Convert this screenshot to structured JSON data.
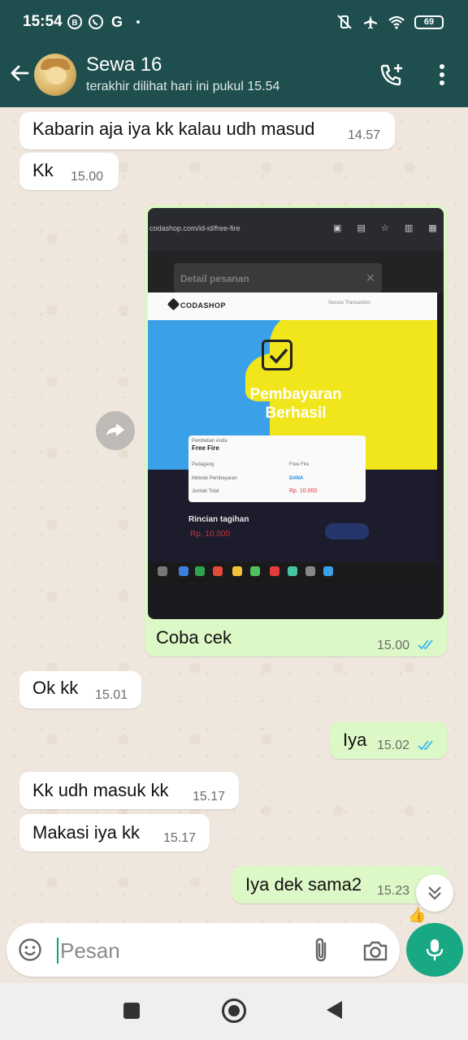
{
  "status_bar": {
    "time": "15:54",
    "notification_icons": [
      "b-icon",
      "whatsapp-icon",
      "google-icon",
      "dot-icon"
    ],
    "battery": "69"
  },
  "header": {
    "contact_name": "Sewa 16",
    "last_seen": "terakhir dilihat hari ini pukul 15.54"
  },
  "messages": [
    {
      "direction": "in",
      "text": "Kabarin aja iya kk kalau udh masud",
      "time": "14.57"
    },
    {
      "direction": "in",
      "text": "Kk",
      "time": "15.00"
    },
    {
      "direction": "out",
      "type": "image",
      "caption": "Coba cek",
      "time": "15.00",
      "read": true
    },
    {
      "direction": "in",
      "text": "Ok kk",
      "time": "15.01"
    },
    {
      "direction": "out",
      "text": "Iya",
      "time": "15.02",
      "read": true
    },
    {
      "direction": "in",
      "text": "Kk udh masuk kk",
      "time": "15.17"
    },
    {
      "direction": "in",
      "text": "Makasi iya kk",
      "time": "15.17"
    },
    {
      "direction": "out",
      "text": "Iya dek sama2",
      "time": "15.23"
    }
  ],
  "image_content": {
    "url": "codashop.com/id-id/free-fire",
    "modal_title": "Detail pesanan",
    "brand": "CODASHOP",
    "secure_text": "Secure Transaction",
    "headline_1": "Pembayaran",
    "headline_2": "Berhasil",
    "receipt": {
      "label_purchase": "Pembelian Anda",
      "game": "Free Fire",
      "label_seller": "Pedagang",
      "seller": "Free Fire",
      "label_method": "Metode Pembayaran",
      "method": "DANA",
      "label_total": "Jumlah Total",
      "total": "Rp. 10.000"
    },
    "rincian_title": "Rincian tagihan",
    "rincian_amount": "Rp. 10.000"
  },
  "input": {
    "placeholder": "Pesan"
  },
  "colors": {
    "header_bg": "#1f4e4e",
    "outgoing_bubble": "#dcf8c6",
    "incoming_bubble": "#ffffff",
    "accent": "#19a884",
    "read_tick": "#34b7f1"
  }
}
